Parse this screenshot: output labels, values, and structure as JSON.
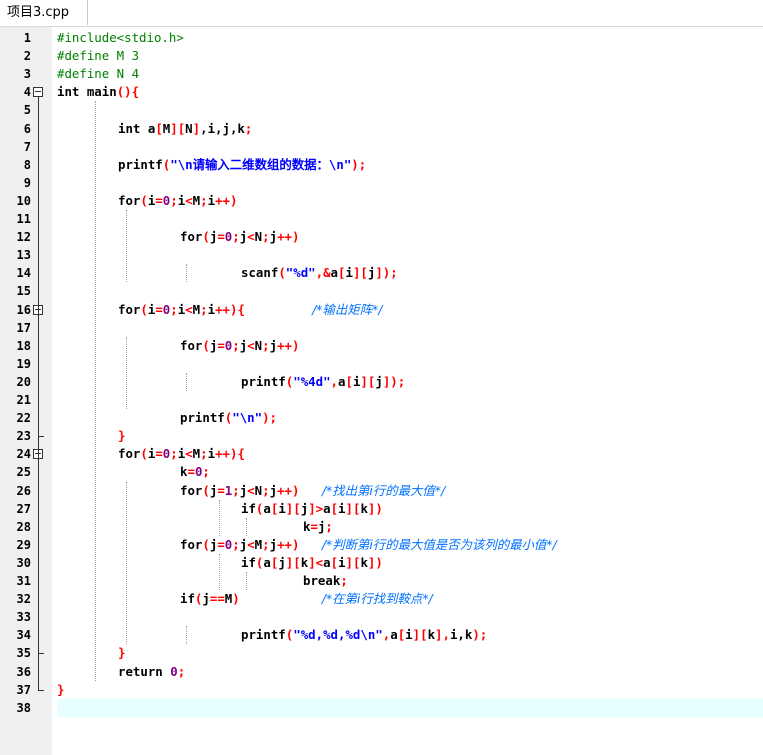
{
  "tab": {
    "label": "项目3.cpp"
  },
  "lines": [
    {
      "n": "1",
      "indent": 0,
      "tokens": [
        [
          "pp",
          "#include<stdio.h>"
        ]
      ]
    },
    {
      "n": "2",
      "indent": 0,
      "tokens": [
        [
          "pp",
          "#define M 3"
        ]
      ]
    },
    {
      "n": "3",
      "indent": 0,
      "tokens": [
        [
          "pp",
          "#define N 4"
        ]
      ]
    },
    {
      "n": "4",
      "indent": 0,
      "tokens": [
        [
          "kw",
          "int main"
        ],
        [
          "op",
          "(){"
        ]
      ]
    },
    {
      "n": "5",
      "indent": 0,
      "tokens": []
    },
    {
      "n": "6",
      "indent": 1,
      "tokens": [
        [
          "kw",
          "int "
        ],
        [
          "tx",
          "a"
        ],
        [
          "op",
          "["
        ],
        [
          "tx",
          "M"
        ],
        [
          "op",
          "]["
        ],
        [
          "tx",
          "N"
        ],
        [
          "op",
          "]"
        ],
        [
          "tx",
          ",i,j,k"
        ],
        [
          "op",
          ";"
        ]
      ]
    },
    {
      "n": "7",
      "indent": 0,
      "tokens": []
    },
    {
      "n": "8",
      "indent": 1,
      "tokens": [
        [
          "tx",
          "printf"
        ],
        [
          "op",
          "("
        ],
        [
          "st",
          "\"\\n请输入二维数组的数据：\\n\""
        ],
        [
          "op",
          ");"
        ]
      ]
    },
    {
      "n": "9",
      "indent": 0,
      "tokens": []
    },
    {
      "n": "10",
      "indent": 1,
      "tokens": [
        [
          "kw",
          "for"
        ],
        [
          "op",
          "("
        ],
        [
          "tx",
          "i"
        ],
        [
          "op",
          "="
        ],
        [
          "nm",
          "0"
        ],
        [
          "op",
          ";"
        ],
        [
          "tx",
          "i"
        ],
        [
          "op",
          "<"
        ],
        [
          "tx",
          "M"
        ],
        [
          "op",
          ";"
        ],
        [
          "tx",
          "i"
        ],
        [
          "op",
          "++)"
        ]
      ]
    },
    {
      "n": "11",
      "indent": 0,
      "tokens": []
    },
    {
      "n": "12",
      "indent": 2,
      "tokens": [
        [
          "kw",
          "for"
        ],
        [
          "op",
          "("
        ],
        [
          "tx",
          "j"
        ],
        [
          "op",
          "="
        ],
        [
          "nm",
          "0"
        ],
        [
          "op",
          ";"
        ],
        [
          "tx",
          "j"
        ],
        [
          "op",
          "<"
        ],
        [
          "tx",
          "N"
        ],
        [
          "op",
          ";"
        ],
        [
          "tx",
          "j"
        ],
        [
          "op",
          "++)"
        ]
      ]
    },
    {
      "n": "13",
      "indent": 0,
      "tokens": []
    },
    {
      "n": "14",
      "indent": 3,
      "tokens": [
        [
          "tx",
          "scanf"
        ],
        [
          "op",
          "("
        ],
        [
          "st",
          "\"%d\""
        ],
        [
          "op",
          ",&"
        ],
        [
          "tx",
          "a"
        ],
        [
          "op",
          "["
        ],
        [
          "tx",
          "i"
        ],
        [
          "op",
          "]["
        ],
        [
          "tx",
          "j"
        ],
        [
          "op",
          "]);"
        ]
      ]
    },
    {
      "n": "15",
      "indent": 0,
      "tokens": []
    },
    {
      "n": "16",
      "indent": 1,
      "tokens": [
        [
          "kw",
          "for"
        ],
        [
          "op",
          "("
        ],
        [
          "tx",
          "i"
        ],
        [
          "op",
          "="
        ],
        [
          "nm",
          "0"
        ],
        [
          "op",
          ";"
        ],
        [
          "tx",
          "i"
        ],
        [
          "op",
          "<"
        ],
        [
          "tx",
          "M"
        ],
        [
          "op",
          ";"
        ],
        [
          "tx",
          "i"
        ],
        [
          "op",
          "++){"
        ],
        [
          "sp",
          "         "
        ],
        [
          "cm",
          "/*输出矩阵*/"
        ]
      ]
    },
    {
      "n": "17",
      "indent": 0,
      "tokens": []
    },
    {
      "n": "18",
      "indent": 2,
      "tokens": [
        [
          "kw",
          "for"
        ],
        [
          "op",
          "("
        ],
        [
          "tx",
          "j"
        ],
        [
          "op",
          "="
        ],
        [
          "nm",
          "0"
        ],
        [
          "op",
          ";"
        ],
        [
          "tx",
          "j"
        ],
        [
          "op",
          "<"
        ],
        [
          "tx",
          "N"
        ],
        [
          "op",
          ";"
        ],
        [
          "tx",
          "j"
        ],
        [
          "op",
          "++)"
        ]
      ]
    },
    {
      "n": "19",
      "indent": 0,
      "tokens": []
    },
    {
      "n": "20",
      "indent": 3,
      "tokens": [
        [
          "tx",
          "printf"
        ],
        [
          "op",
          "("
        ],
        [
          "st",
          "\"%4d\""
        ],
        [
          "op",
          ","
        ],
        [
          "tx",
          "a"
        ],
        [
          "op",
          "["
        ],
        [
          "tx",
          "i"
        ],
        [
          "op",
          "]["
        ],
        [
          "tx",
          "j"
        ],
        [
          "op",
          "]);"
        ]
      ]
    },
    {
      "n": "21",
      "indent": 0,
      "tokens": []
    },
    {
      "n": "22",
      "indent": 2,
      "tokens": [
        [
          "tx",
          "printf"
        ],
        [
          "op",
          "("
        ],
        [
          "st",
          "\"\\n\""
        ],
        [
          "op",
          ");"
        ]
      ]
    },
    {
      "n": "23",
      "indent": 1,
      "tokens": [
        [
          "op",
          "}"
        ]
      ]
    },
    {
      "n": "24",
      "indent": 1,
      "tokens": [
        [
          "kw",
          "for"
        ],
        [
          "op",
          "("
        ],
        [
          "tx",
          "i"
        ],
        [
          "op",
          "="
        ],
        [
          "nm",
          "0"
        ],
        [
          "op",
          ";"
        ],
        [
          "tx",
          "i"
        ],
        [
          "op",
          "<"
        ],
        [
          "tx",
          "M"
        ],
        [
          "op",
          ";"
        ],
        [
          "tx",
          "i"
        ],
        [
          "op",
          "++){"
        ]
      ]
    },
    {
      "n": "25",
      "indent": 2,
      "tokens": [
        [
          "tx",
          "k"
        ],
        [
          "op",
          "="
        ],
        [
          "nm",
          "0"
        ],
        [
          "op",
          ";"
        ]
      ]
    },
    {
      "n": "26",
      "indent": 2,
      "tokens": [
        [
          "kw",
          "for"
        ],
        [
          "op",
          "("
        ],
        [
          "tx",
          "j"
        ],
        [
          "op",
          "="
        ],
        [
          "nm",
          "1"
        ],
        [
          "op",
          ";"
        ],
        [
          "tx",
          "j"
        ],
        [
          "op",
          "<"
        ],
        [
          "tx",
          "N"
        ],
        [
          "op",
          ";"
        ],
        [
          "tx",
          "j"
        ],
        [
          "op",
          "++)"
        ],
        [
          "sp",
          "   "
        ],
        [
          "cm",
          "/*找出第i行的最大值*/"
        ]
      ]
    },
    {
      "n": "27",
      "indent": 3,
      "tokens": [
        [
          "kw",
          "if"
        ],
        [
          "op",
          "("
        ],
        [
          "tx",
          "a"
        ],
        [
          "op",
          "["
        ],
        [
          "tx",
          "i"
        ],
        [
          "op",
          "]["
        ],
        [
          "tx",
          "j"
        ],
        [
          "op",
          "]>"
        ],
        [
          "tx",
          "a"
        ],
        [
          "op",
          "["
        ],
        [
          "tx",
          "i"
        ],
        [
          "op",
          "]["
        ],
        [
          "tx",
          "k"
        ],
        [
          "op",
          "])"
        ]
      ]
    },
    {
      "n": "28",
      "indent": 4,
      "tokens": [
        [
          "tx",
          "k"
        ],
        [
          "op",
          "="
        ],
        [
          "tx",
          "j"
        ],
        [
          "op",
          ";"
        ]
      ]
    },
    {
      "n": "29",
      "indent": 2,
      "tokens": [
        [
          "kw",
          "for"
        ],
        [
          "op",
          "("
        ],
        [
          "tx",
          "j"
        ],
        [
          "op",
          "="
        ],
        [
          "nm",
          "0"
        ],
        [
          "op",
          ";"
        ],
        [
          "tx",
          "j"
        ],
        [
          "op",
          "<"
        ],
        [
          "tx",
          "M"
        ],
        [
          "op",
          ";"
        ],
        [
          "tx",
          "j"
        ],
        [
          "op",
          "++)"
        ],
        [
          "sp",
          "   "
        ],
        [
          "cm",
          "/*判断第i行的最大值是否为该列的最小值*/"
        ]
      ]
    },
    {
      "n": "30",
      "indent": 3,
      "tokens": [
        [
          "kw",
          "if"
        ],
        [
          "op",
          "("
        ],
        [
          "tx",
          "a"
        ],
        [
          "op",
          "["
        ],
        [
          "tx",
          "j"
        ],
        [
          "op",
          "]["
        ],
        [
          "tx",
          "k"
        ],
        [
          "op",
          "]<"
        ],
        [
          "tx",
          "a"
        ],
        [
          "op",
          "["
        ],
        [
          "tx",
          "i"
        ],
        [
          "op",
          "]["
        ],
        [
          "tx",
          "k"
        ],
        [
          "op",
          "])"
        ]
      ]
    },
    {
      "n": "31",
      "indent": 4,
      "tokens": [
        [
          "kw",
          "break"
        ],
        [
          "op",
          ";"
        ]
      ]
    },
    {
      "n": "32",
      "indent": 2,
      "tokens": [
        [
          "kw",
          "if"
        ],
        [
          "op",
          "("
        ],
        [
          "tx",
          "j"
        ],
        [
          "op",
          "=="
        ],
        [
          "tx",
          "M"
        ],
        [
          "op",
          ")"
        ],
        [
          "sp",
          "           "
        ],
        [
          "cm",
          "/*在第i行找到鞍点*/"
        ]
      ]
    },
    {
      "n": "33",
      "indent": 0,
      "tokens": []
    },
    {
      "n": "34",
      "indent": 3,
      "tokens": [
        [
          "tx",
          "printf"
        ],
        [
          "op",
          "("
        ],
        [
          "st",
          "\"%d,%d,%d\\n\""
        ],
        [
          "op",
          ","
        ],
        [
          "tx",
          "a"
        ],
        [
          "op",
          "["
        ],
        [
          "tx",
          "i"
        ],
        [
          "op",
          "]["
        ],
        [
          "tx",
          "k"
        ],
        [
          "op",
          "],"
        ],
        [
          "tx",
          "i,k"
        ],
        [
          "op",
          ");"
        ]
      ]
    },
    {
      "n": "35",
      "indent": 1,
      "tokens": [
        [
          "op",
          "}"
        ]
      ]
    },
    {
      "n": "36",
      "indent": 1,
      "tokens": [
        [
          "kw",
          "return "
        ],
        [
          "nm",
          "0"
        ],
        [
          "op",
          ";"
        ]
      ]
    },
    {
      "n": "37",
      "indent": 0,
      "tokens": [
        [
          "op",
          "}"
        ]
      ]
    },
    {
      "n": "38",
      "indent": 0,
      "tokens": []
    }
  ],
  "colors": {
    "preprocessor": "#008000",
    "operator": "#ff0000",
    "string": "#0000ff",
    "number": "#800080",
    "comment": "#0070ff",
    "current_line": "#e8ffff"
  }
}
